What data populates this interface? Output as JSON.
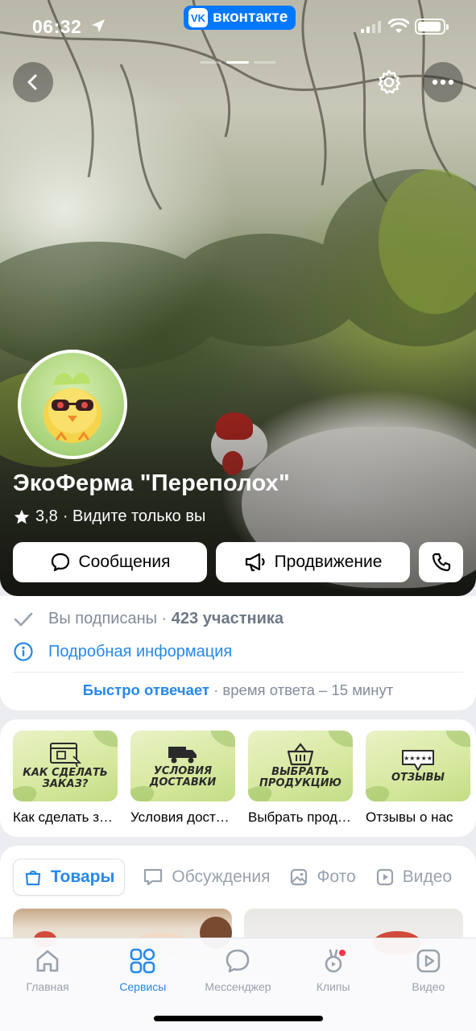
{
  "status_bar": {
    "time": "06:32",
    "app_badge": "вконтакте",
    "app_badge_logo": "VK"
  },
  "community": {
    "name": "ЭкоФерма \"Переполох\"",
    "rating": "3,8",
    "visibility": "· Видите только вы"
  },
  "actions": {
    "messages_label": "Сообщения",
    "promo_label": "Продвижение"
  },
  "info": {
    "subscribed_label": "Вы подписаны ·",
    "members_count": "423 участника",
    "details_label": "Подробная информация",
    "fast_answer": "Быстро отвечает",
    "answer_time": " · время ответа – 15 минут"
  },
  "services": [
    {
      "thumb_text": "Как сделать заказ?",
      "label": "Как сделать заказ?"
    },
    {
      "thumb_text": "Условия доставки",
      "label": "Условия доставки"
    },
    {
      "thumb_text": "Выбрать продукцию",
      "label": "Выбрать продукцию"
    },
    {
      "thumb_text": "Отзывы",
      "label": "Отзывы о нас"
    }
  ],
  "tabs": [
    {
      "label": "Товары",
      "icon": "bag-icon"
    },
    {
      "label": "Обсуждения",
      "icon": "chat-bubble-icon"
    },
    {
      "label": "Фото",
      "icon": "image-icon"
    },
    {
      "label": "Видео",
      "icon": "play-icon"
    }
  ],
  "bottom_nav": [
    {
      "label": "Главная",
      "icon": "home-icon"
    },
    {
      "label": "Сервисы",
      "icon": "grid-icon"
    },
    {
      "label": "Мессенджер",
      "icon": "chat-icon"
    },
    {
      "label": "Клипы",
      "icon": "clips-icon"
    },
    {
      "label": "Видео",
      "icon": "video-icon"
    }
  ],
  "colors": {
    "accent": "#2688eb",
    "vk_blue": "#0077ff",
    "secondary_text": "#818c99"
  }
}
